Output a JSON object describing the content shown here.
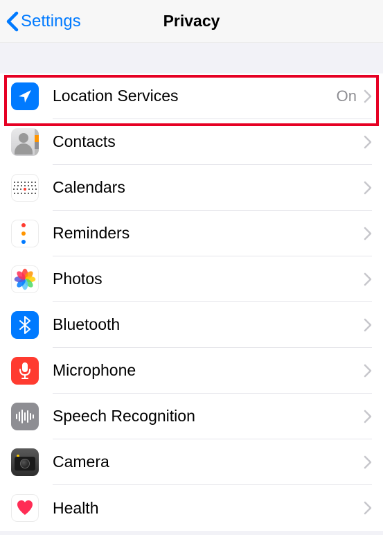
{
  "navbar": {
    "back_label": "Settings",
    "title": "Privacy"
  },
  "rows": {
    "location": {
      "label": "Location Services",
      "value": "On"
    },
    "contacts": {
      "label": "Contacts"
    },
    "calendars": {
      "label": "Calendars"
    },
    "reminders": {
      "label": "Reminders"
    },
    "photos": {
      "label": "Photos"
    },
    "bluetooth": {
      "label": "Bluetooth"
    },
    "microphone": {
      "label": "Microphone"
    },
    "speech": {
      "label": "Speech Recognition"
    },
    "camera": {
      "label": "Camera"
    },
    "health": {
      "label": "Health"
    }
  },
  "highlight": {
    "target": "location-services-row"
  }
}
